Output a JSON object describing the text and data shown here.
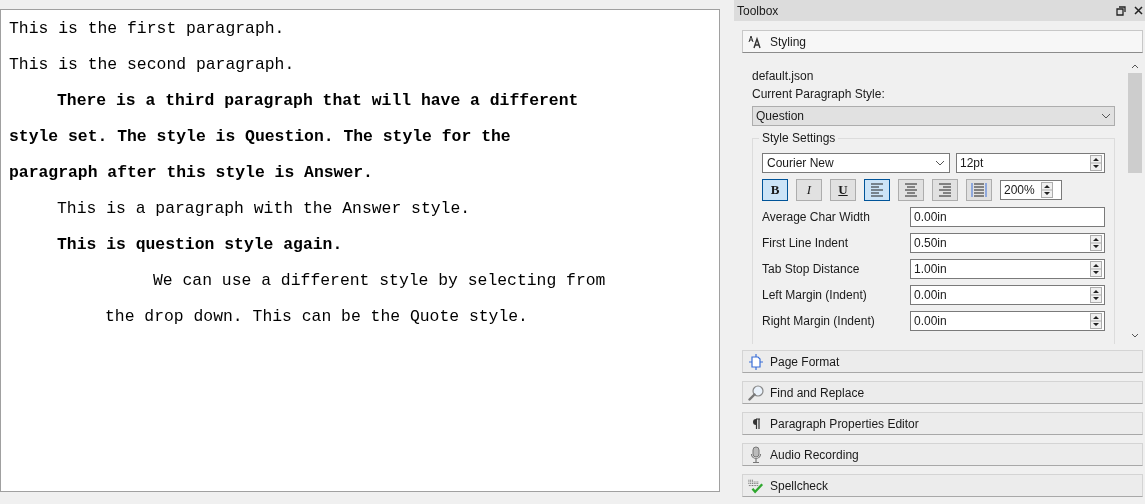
{
  "document": {
    "paragraphs": [
      {
        "kind": "normal",
        "lines": [
          "This is the first paragraph."
        ]
      },
      {
        "kind": "normal",
        "lines": [
          "This is the second paragraph."
        ]
      },
      {
        "kind": "question",
        "lines": [
          "There is a third paragraph that will have a different",
          "style set. The style is Question. The style for the",
          "paragraph after this style is Answer."
        ]
      },
      {
        "kind": "answer",
        "lines": [
          "This is a paragraph with the Answer style."
        ]
      },
      {
        "kind": "question",
        "lines": [
          "This is question style again."
        ]
      },
      {
        "kind": "quote",
        "lines": [
          "We can use a different style by selecting from",
          "the drop down. This can be the Quote style."
        ]
      }
    ]
  },
  "toolbox": {
    "title": "Toolbox",
    "sections": [
      {
        "kind": "styling",
        "label": "Styling",
        "expanded": true
      },
      {
        "kind": "page",
        "label": "Page Format",
        "expanded": false
      },
      {
        "kind": "find",
        "label": "Find and Replace",
        "expanded": false
      },
      {
        "kind": "paragraph",
        "label": "Paragraph Properties Editor",
        "expanded": false
      },
      {
        "kind": "audio",
        "label": "Audio Recording",
        "expanded": false
      },
      {
        "kind": "spellcheck",
        "label": "Spellcheck",
        "expanded": false
      }
    ],
    "styling": {
      "file": "default.json",
      "style_label": "Current Paragraph Style:",
      "style_value": "Question",
      "group_title": "Style Settings",
      "font": "Courier New",
      "size": "12pt",
      "format_buttons": [
        {
          "kind": "bold",
          "label": "B",
          "selected": true
        },
        {
          "kind": "italic",
          "label": "I",
          "selected": false
        },
        {
          "kind": "underline",
          "label": "U",
          "selected": false
        },
        {
          "kind": "align-left",
          "selected": true
        },
        {
          "kind": "align-center",
          "selected": false
        },
        {
          "kind": "align-right",
          "selected": false
        },
        {
          "kind": "line-spacing",
          "selected": false
        }
      ],
      "line_spacing": "200%",
      "fields": [
        {
          "kind": "text",
          "label": "Average Char Width",
          "value": "0.00in"
        },
        {
          "kind": "spin",
          "label": "First Line Indent",
          "value": "0.50in"
        },
        {
          "kind": "spin",
          "label": "Tab Stop Distance",
          "value": "1.00in"
        },
        {
          "kind": "spin",
          "label": "Left Margin (Indent)",
          "value": "0.00in"
        },
        {
          "kind": "spin",
          "label": "Right Margin (Indent)",
          "value": "0.00in"
        }
      ]
    }
  }
}
